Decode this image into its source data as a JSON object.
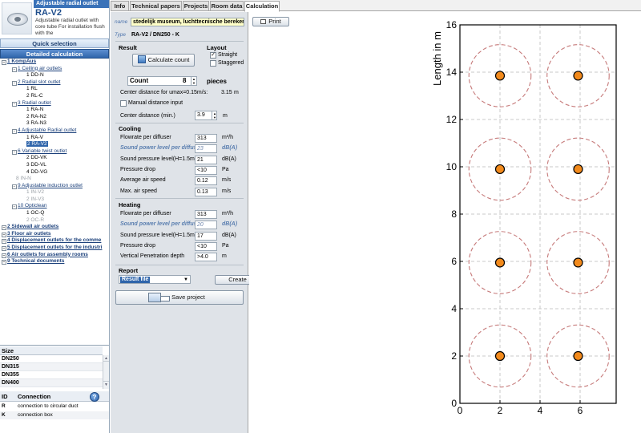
{
  "product": {
    "category_bar": "Adjustable radial outlet",
    "name": "RA-V2",
    "description": "Adjustable radial outlet with core tube For installation flush with the"
  },
  "left_nav": {
    "quick_selection": "Quick selection",
    "detailed_calculation": "Detailed calculation"
  },
  "tree": [
    {
      "label": "1 KompAus",
      "level": 0,
      "state": "link"
    },
    {
      "label": "1 Ceiling air outlets",
      "level": 1,
      "state": "link"
    },
    {
      "label": "1 DD-N",
      "level": 2,
      "state": "leaf"
    },
    {
      "label": "2 Radial slot outlet",
      "level": 1,
      "state": "link"
    },
    {
      "label": "1 RL",
      "level": 2,
      "state": "leaf"
    },
    {
      "label": "2 RL-C",
      "level": 2,
      "state": "leaf"
    },
    {
      "label": "3 Radial outlet",
      "level": 1,
      "state": "link"
    },
    {
      "label": "1 RA-N",
      "level": 2,
      "state": "leaf"
    },
    {
      "label": "2 RA-N2",
      "level": 2,
      "state": "leaf"
    },
    {
      "label": "3 RA-N3",
      "level": 2,
      "state": "leaf"
    },
    {
      "label": "4 Adjustable Radial outlet",
      "level": 1,
      "state": "link"
    },
    {
      "label": "1 RA-V",
      "level": 2,
      "state": "leaf"
    },
    {
      "label": "2 RA-V2",
      "level": 2,
      "state": "selected"
    },
    {
      "label": "6 Variable twist outlet",
      "level": 1,
      "state": "link"
    },
    {
      "label": "2 DD-VK",
      "level": 2,
      "state": "leaf"
    },
    {
      "label": "3 DD-VL",
      "level": 2,
      "state": "leaf"
    },
    {
      "label": "4 DD-VG",
      "level": 2,
      "state": "leaf"
    },
    {
      "label": "8 IN-N",
      "level": 1,
      "state": "grey"
    },
    {
      "label": "9 Adjustable induction outlet",
      "level": 1,
      "state": "link"
    },
    {
      "label": "1 IN-V2",
      "level": 2,
      "state": "grey"
    },
    {
      "label": "2 IN-V3",
      "level": 2,
      "state": "grey"
    },
    {
      "label": "10 Opticlean",
      "level": 1,
      "state": "link"
    },
    {
      "label": "1 OC-Q",
      "level": 2,
      "state": "leaf"
    },
    {
      "label": "2 OC-R",
      "level": 2,
      "state": "grey"
    },
    {
      "label": "2 Sidewall air outlets",
      "level": 0,
      "state": "link"
    },
    {
      "label": "3 Floor air outlets",
      "level": 0,
      "state": "link"
    },
    {
      "label": "4 Displacement outlets for the comme",
      "level": 0,
      "state": "link"
    },
    {
      "label": "5 Displacement outlets for the industri",
      "level": 0,
      "state": "link"
    },
    {
      "label": "6 Air outlets for assembly rooms",
      "level": 0,
      "state": "link"
    },
    {
      "label": "9 Technical documents",
      "level": 0,
      "state": "link"
    }
  ],
  "sizes": {
    "header": "Size",
    "rows": [
      "DN250",
      "DN315",
      "DN355",
      "DN400"
    ]
  },
  "connections": {
    "header_id": "ID",
    "header_conn": "Connection",
    "rows": [
      {
        "id": "R",
        "text": "connection to circular duct"
      },
      {
        "id": "K",
        "text": "connection box"
      }
    ]
  },
  "tabs": [
    "Info",
    "Technical papers",
    "Projects",
    "Room data",
    "Calculation"
  ],
  "form": {
    "name_label": "name",
    "name_value": "stedelijk museum, luchttecnische bereker",
    "type_label": "Type",
    "type_value": "RA-V2 / DN250 - K",
    "result_heading": "Result",
    "calc_button": "Calculate count",
    "layout_heading": "Layout",
    "straight": "Straight",
    "staggered": "Staggered",
    "count_label": "Count",
    "count_value": "8",
    "pieces": "pieces",
    "center_distance_text": "Center distance for umax=0.15m/s:",
    "center_distance_value": "3.15",
    "center_distance_unit": "m",
    "manual_distance": "Manual distance input",
    "center_min_label": "Center distance (min.)",
    "center_min_value": "3.9",
    "center_min_unit": "m",
    "cooling_heading": "Cooling",
    "cooling": [
      {
        "label": "Flowrate per diffuser",
        "value": "313",
        "unit": "m³/h",
        "style": "normal"
      },
      {
        "label": "Sound power level per diffuser",
        "value": "23",
        "unit": "dB(A)",
        "style": "italic"
      },
      {
        "label": "Sound pressure level(H=1.5m)",
        "value": "21",
        "unit": "dB(A)",
        "style": "normal"
      },
      {
        "label": "Pressure drop",
        "value": "<10",
        "unit": "Pa",
        "style": "normal"
      },
      {
        "label": "Average air speed",
        "value": "0.12",
        "unit": "m/s",
        "style": "normal"
      },
      {
        "label": "Max. air speed",
        "value": "0.13",
        "unit": "m/s",
        "style": "normal"
      }
    ],
    "heating_heading": "Heating",
    "heating": [
      {
        "label": "Flowrate per diffuser",
        "value": "313",
        "unit": "m³/h",
        "style": "normal"
      },
      {
        "label": "Sound power level per diffuser",
        "value": "20",
        "unit": "dB(A)",
        "style": "italic"
      },
      {
        "label": "Sound pressure level(H=1.5m)",
        "value": "17",
        "unit": "dB(A)",
        "style": "normal"
      },
      {
        "label": "Pressure drop",
        "value": "<10",
        "unit": "Pa",
        "style": "normal"
      },
      {
        "label": "Vertical Penetration depth",
        "value": ">4.0",
        "unit": "m",
        "style": "normal"
      }
    ],
    "report_heading": "Report",
    "report_select": "Result file",
    "create_button": "Create",
    "save_button": "Save project"
  },
  "print_button": "Print",
  "colors": {
    "accent": "#2f65ab",
    "diffuser": "#f28a1c",
    "circle": "#c67a7a"
  },
  "chart_data": {
    "type": "scatter",
    "title": "",
    "xlabel": "",
    "ylabel": "Length in m",
    "xlim": [
      0,
      7.8
    ],
    "ylim": [
      0,
      16
    ],
    "xticks": [
      0,
      2,
      4,
      6,
      8
    ],
    "yticks": [
      0,
      2,
      4,
      6,
      8,
      10,
      12,
      14,
      16
    ],
    "grid": true,
    "points": [
      {
        "x": 2,
        "y": 2
      },
      {
        "x": 5.9,
        "y": 2
      },
      {
        "x": 2,
        "y": 5.95
      },
      {
        "x": 5.9,
        "y": 5.95
      },
      {
        "x": 2,
        "y": 9.9
      },
      {
        "x": 5.9,
        "y": 9.9
      },
      {
        "x": 2,
        "y": 13.85
      },
      {
        "x": 5.9,
        "y": 13.85
      }
    ],
    "circle_radius": 1.55
  }
}
